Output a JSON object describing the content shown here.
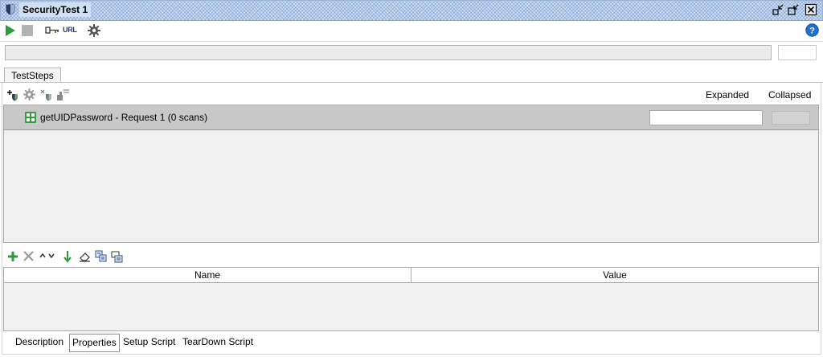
{
  "window": {
    "title": "SecurityTest 1",
    "icons": [
      "shield-icon",
      "minimize-window-icon",
      "restore-window-icon",
      "close-window-icon"
    ]
  },
  "toolbar": {
    "icons": [
      "run-icon",
      "stop-icon",
      "key-icon",
      "url-icon",
      "gear-icon",
      "help-icon"
    ],
    "url_label": "URL"
  },
  "progress": {
    "value": 0,
    "text": ""
  },
  "tabs": {
    "active": "TestSteps"
  },
  "steps_toolbar": {
    "icons": [
      "add-scan-icon",
      "configure-icon",
      "remove-scan-icon",
      "assertions-icon"
    ],
    "expanded_label": "Expanded",
    "collapsed_label": "Collapsed"
  },
  "test_steps": [
    {
      "label": "getUIDPassword - Request 1 (0 scans)",
      "icon": "soap-request-icon"
    }
  ],
  "properties_toolbar": {
    "icons": [
      "add-icon",
      "delete-icon",
      "move-up-icon",
      "move-down-icon",
      "sort-icon",
      "clear-icon",
      "load-icon",
      "save-icon"
    ]
  },
  "properties_table": {
    "columns": [
      "Name",
      "Value"
    ],
    "rows": []
  },
  "bottom_tabs": [
    "Description",
    "Properties",
    "Setup Script",
    "TearDown Script"
  ],
  "colors": {
    "titlebar": "#cfe0f5",
    "run_green": "#2e9a3a",
    "step_row": "#c8c8c8",
    "help_blue": "#1d6fd0"
  }
}
